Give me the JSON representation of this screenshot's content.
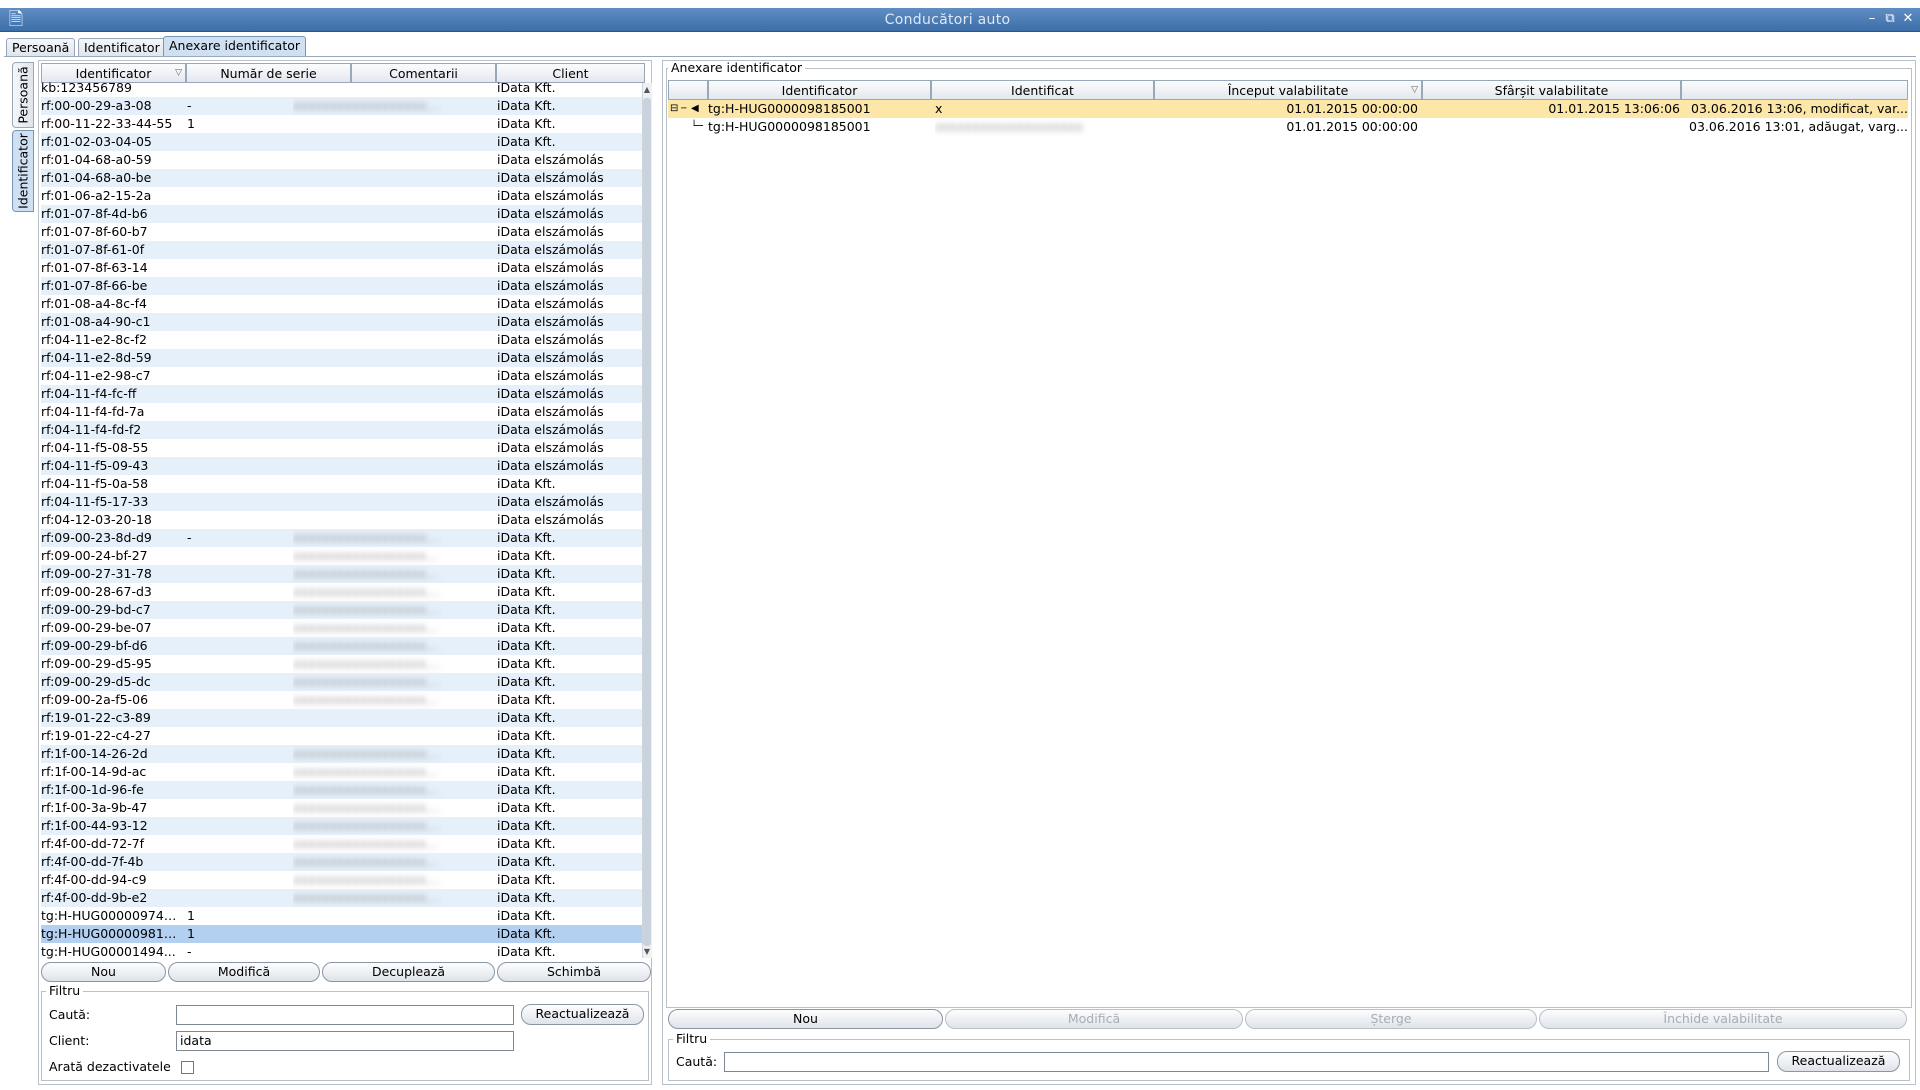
{
  "window": {
    "title": "Conducători auto"
  },
  "main_tabs": [
    {
      "label": "Persoană"
    },
    {
      "label": "Identificator"
    },
    {
      "label": "Anexare identificator"
    }
  ],
  "side_tabs": [
    {
      "label": "Persoană"
    },
    {
      "label": "Identificator"
    }
  ],
  "left_table": {
    "columns": [
      "Identificator",
      "Număr de serie",
      "Comentarii",
      "Client"
    ],
    "rows": [
      {
        "id": "kb:123456789",
        "serial": "",
        "comment": "",
        "client": "iData Kft."
      },
      {
        "id": "rf:00-00-29-a3-08",
        "serial": "-",
        "comment": "blurred",
        "client": "iData Kft."
      },
      {
        "id": "rf:00-11-22-33-44-55",
        "serial": "1",
        "comment": "",
        "client": "iData Kft."
      },
      {
        "id": "rf:01-02-03-04-05",
        "serial": "",
        "comment": "",
        "client": "iData Kft."
      },
      {
        "id": "rf:01-04-68-a0-59",
        "serial": "",
        "comment": "",
        "client": "iData elszámolás"
      },
      {
        "id": "rf:01-04-68-a0-be",
        "serial": "",
        "comment": "",
        "client": "iData elszámolás"
      },
      {
        "id": "rf:01-06-a2-15-2a",
        "serial": "",
        "comment": "",
        "client": "iData elszámolás"
      },
      {
        "id": "rf:01-07-8f-4d-b6",
        "serial": "",
        "comment": "",
        "client": "iData elszámolás"
      },
      {
        "id": "rf:01-07-8f-60-b7",
        "serial": "",
        "comment": "",
        "client": "iData elszámolás"
      },
      {
        "id": "rf:01-07-8f-61-0f",
        "serial": "",
        "comment": "",
        "client": "iData elszámolás"
      },
      {
        "id": "rf:01-07-8f-63-14",
        "serial": "",
        "comment": "",
        "client": "iData elszámolás"
      },
      {
        "id": "rf:01-07-8f-66-be",
        "serial": "",
        "comment": "",
        "client": "iData elszámolás"
      },
      {
        "id": "rf:01-08-a4-8c-f4",
        "serial": "",
        "comment": "",
        "client": "iData elszámolás"
      },
      {
        "id": "rf:01-08-a4-90-c1",
        "serial": "",
        "comment": "",
        "client": "iData elszámolás"
      },
      {
        "id": "rf:04-11-e2-8c-f2",
        "serial": "",
        "comment": "",
        "client": "iData elszámolás"
      },
      {
        "id": "rf:04-11-e2-8d-59",
        "serial": "",
        "comment": "",
        "client": "iData elszámolás"
      },
      {
        "id": "rf:04-11-e2-98-c7",
        "serial": "",
        "comment": "",
        "client": "iData elszámolás"
      },
      {
        "id": "rf:04-11-f4-fc-ff",
        "serial": "",
        "comment": "",
        "client": "iData elszámolás"
      },
      {
        "id": "rf:04-11-f4-fd-7a",
        "serial": "",
        "comment": "",
        "client": "iData elszámolás"
      },
      {
        "id": "rf:04-11-f4-fd-f2",
        "serial": "",
        "comment": "",
        "client": "iData elszámolás"
      },
      {
        "id": "rf:04-11-f5-08-55",
        "serial": "",
        "comment": "",
        "client": "iData elszámolás"
      },
      {
        "id": "rf:04-11-f5-09-43",
        "serial": "",
        "comment": "",
        "client": "iData elszámolás"
      },
      {
        "id": "rf:04-11-f5-0a-58",
        "serial": "",
        "comment": "",
        "client": "iData Kft."
      },
      {
        "id": "rf:04-11-f5-17-33",
        "serial": "",
        "comment": "",
        "client": "iData elszámolás"
      },
      {
        "id": "rf:04-12-03-20-18",
        "serial": "",
        "comment": "",
        "client": "iData elszámolás"
      },
      {
        "id": "rf:09-00-23-8d-d9",
        "serial": "-",
        "comment": "blurred",
        "client": "iData Kft."
      },
      {
        "id": "rf:09-00-24-bf-27",
        "serial": "",
        "comment": "blurred",
        "client": "iData Kft."
      },
      {
        "id": "rf:09-00-27-31-78",
        "serial": "",
        "comment": "blurred",
        "client": "iData Kft."
      },
      {
        "id": "rf:09-00-28-67-d3",
        "serial": "",
        "comment": "blurred",
        "client": "iData Kft."
      },
      {
        "id": "rf:09-00-29-bd-c7",
        "serial": "",
        "comment": "blurred",
        "client": "iData Kft."
      },
      {
        "id": "rf:09-00-29-be-07",
        "serial": "",
        "comment": "blurred",
        "client": "iData Kft."
      },
      {
        "id": "rf:09-00-29-bf-d6",
        "serial": "",
        "comment": "blurred",
        "client": "iData Kft."
      },
      {
        "id": "rf:09-00-29-d5-95",
        "serial": "",
        "comment": "blurred",
        "client": "iData Kft."
      },
      {
        "id": "rf:09-00-29-d5-dc",
        "serial": "",
        "comment": "blurred",
        "client": "iData Kft."
      },
      {
        "id": "rf:09-00-2a-f5-06",
        "serial": "",
        "comment": "blurred",
        "client": "iData Kft."
      },
      {
        "id": "rf:19-01-22-c3-89",
        "serial": "",
        "comment": "",
        "client": "iData Kft."
      },
      {
        "id": "rf:19-01-22-c4-27",
        "serial": "",
        "comment": "",
        "client": "iData Kft."
      },
      {
        "id": "rf:1f-00-14-26-2d",
        "serial": "",
        "comment": "blurred",
        "client": "iData Kft."
      },
      {
        "id": "rf:1f-00-14-9d-ac",
        "serial": "",
        "comment": "blurred",
        "client": "iData Kft."
      },
      {
        "id": "rf:1f-00-1d-96-fe",
        "serial": "",
        "comment": "blurred",
        "client": "iData Kft."
      },
      {
        "id": "rf:1f-00-3a-9b-47",
        "serial": "",
        "comment": "blurred",
        "client": "iData Kft."
      },
      {
        "id": "rf:1f-00-44-93-12",
        "serial": "",
        "comment": "blurred",
        "client": "iData Kft."
      },
      {
        "id": "rf:4f-00-dd-72-7f",
        "serial": "",
        "comment": "blurred",
        "client": "iData Kft."
      },
      {
        "id": "rf:4f-00-dd-7f-4b",
        "serial": "",
        "comment": "blurred",
        "client": "iData Kft."
      },
      {
        "id": "rf:4f-00-dd-94-c9",
        "serial": "",
        "comment": "blurred",
        "client": "iData Kft."
      },
      {
        "id": "rf:4f-00-dd-9b-e2",
        "serial": "",
        "comment": "blurred",
        "client": "iData Kft."
      },
      {
        "id": "tg:H-HUG000009746...",
        "serial": "1",
        "comment": "",
        "client": "iData Kft."
      },
      {
        "id": "tg:H-HUG000009818...",
        "serial": "1",
        "comment": "",
        "client": "iData Kft.",
        "selected": true
      },
      {
        "id": "tg:H-HUG00001494...",
        "serial": "-",
        "comment": "",
        "client": "iData Kft."
      }
    ]
  },
  "left_buttons": {
    "new": "Nou",
    "modify": "Modifică",
    "detach": "Decuplează",
    "change": "Schimbă"
  },
  "left_filter": {
    "legend": "Filtru",
    "search_label": "Caută:",
    "search_value": "",
    "refresh": "Reactualizează",
    "client_label": "Client:",
    "client_value": "idata",
    "show_disabled_label": "Arată dezactivatele"
  },
  "right_panel": {
    "legend": "Anexare identificator",
    "columns": [
      "Identificator",
      "Identificat",
      "Început valabilitate",
      "Sfârșit valabilitate",
      ""
    ],
    "rows": [
      {
        "id": "tg:H-HUG0000098185001",
        "identified": "x",
        "start": "01.01.2015 00:00:00",
        "end": "01.01.2015 13:06:06",
        "note": "03.06.2016 13:06, modificat, var...",
        "level": 0
      },
      {
        "id": "tg:H-HUG0000098185001",
        "identified": "",
        "start": "01.01.2015 00:00:00",
        "end": "",
        "note": "03.06.2016 13:01, adăugat, varg...",
        "level": 1
      }
    ],
    "buttons": {
      "new": "Nou",
      "modify": "Modifică",
      "delete": "Șterge",
      "close_validity": "Închide valabilitate"
    },
    "filter": {
      "legend": "Filtru",
      "search_label": "Caută:",
      "search_value": "",
      "refresh": "Reactualizează"
    }
  },
  "colors": {
    "titlebar": "#4a7ab5",
    "row_alt": "#e6f0fa",
    "row_selected": "#b4d0f0",
    "tree_highlight": "#fce6a8"
  }
}
